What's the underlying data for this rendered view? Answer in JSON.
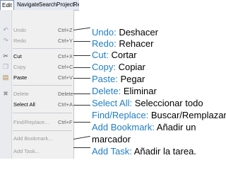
{
  "menubar": {
    "items": [
      "Edit",
      "Navigate",
      "Search",
      "Project",
      "Re"
    ]
  },
  "menu": {
    "items": [
      {
        "label": "Undo",
        "shortcut": "Ctrl+Z",
        "icon": "undo-icon",
        "disabled": true
      },
      {
        "label": "Redo",
        "shortcut": "Ctrl+Y",
        "icon": "redo-icon",
        "disabled": true
      },
      {
        "label": "Cut",
        "shortcut": "Ctrl+X",
        "icon": "scissors-icon",
        "disabled": false
      },
      {
        "label": "Copy",
        "shortcut": "Ctrl+C",
        "icon": "copy-icon",
        "disabled": true
      },
      {
        "label": "Paste",
        "shortcut": "Ctrl+V",
        "icon": "paste-icon",
        "disabled": false
      },
      {
        "label": "Delete",
        "shortcut": "Delete",
        "icon": "delete-icon",
        "disabled": true
      },
      {
        "label": "Select All",
        "shortcut": "Ctrl+A",
        "icon": "",
        "disabled": false
      },
      {
        "label": "Find/Replace...",
        "shortcut": "Ctrl+F",
        "icon": "",
        "disabled": true
      },
      {
        "label": "Add Bookmark...",
        "shortcut": "",
        "icon": "",
        "disabled": true
      },
      {
        "label": "Add Task...",
        "shortcut": "",
        "icon": "",
        "disabled": true
      }
    ]
  },
  "annotations": [
    {
      "key": "Undo:",
      "value": " Deshacer"
    },
    {
      "key": "Redo:",
      "value": " Rehacer"
    },
    {
      "key": "Cut:",
      "value": " Cortar"
    },
    {
      "key": "Copy:",
      "value": " Copiar"
    },
    {
      "key": "Paste:",
      "value": " Pegar"
    },
    {
      "key": "Delete:",
      "value": " Eliminar"
    },
    {
      "key": "Select All:",
      "value": " Seleccionar todo"
    },
    {
      "key": "Find/Replace:",
      "value": " Buscar/Remplazar"
    },
    {
      "key": "Add Bookmark:",
      "value": " Añadir un"
    },
    {
      "key": "",
      "value": "marcador"
    },
    {
      "key": "Add Task:",
      "value": " Añadir la tarea."
    }
  ],
  "colors": {
    "accent": "#1f7ec4"
  }
}
